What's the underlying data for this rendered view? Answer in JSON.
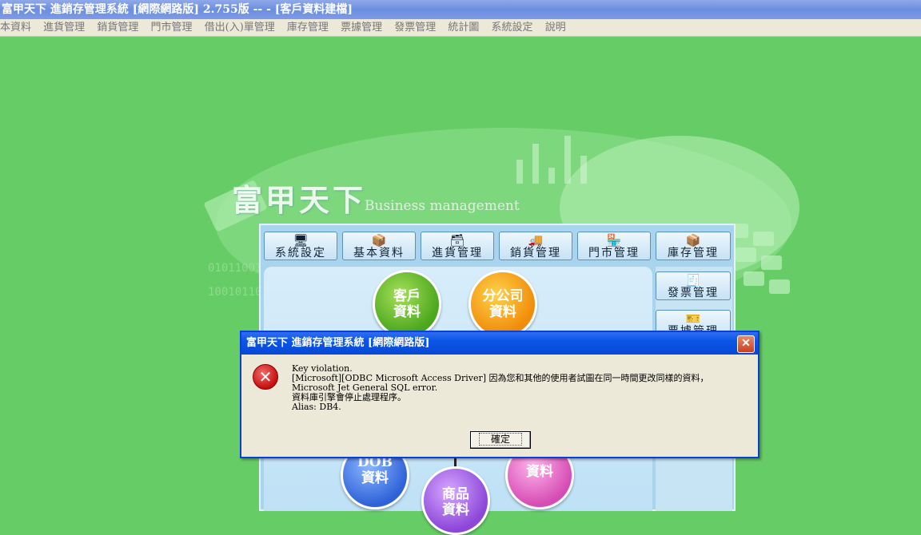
{
  "window": {
    "title": "富甲天下 進銷存管理系統 [網際網路版] 2.755版 -- - [客戶資料建檔]"
  },
  "menu": {
    "items": [
      "本資料",
      "進貨管理",
      "銷貨管理",
      "門市管理",
      "借出(入)單管理",
      "庫存管理",
      "票據管理",
      "發票管理",
      "統計圖",
      "系統設定",
      "說明"
    ]
  },
  "brand": {
    "name": "富甲天下",
    "tagline": "Business management"
  },
  "toolbar": {
    "buttons": [
      {
        "label": "系統設定",
        "icon": "computer-icon"
      },
      {
        "label": "基本資料",
        "icon": "box-icon"
      },
      {
        "label": "進貨管理",
        "icon": "boxes-icon"
      },
      {
        "label": "銷貨管理",
        "icon": "truck-icon"
      },
      {
        "label": "門市管理",
        "icon": "store-icon"
      },
      {
        "label": "庫存管理",
        "icon": "crates-icon"
      },
      {
        "label": "發票管理",
        "icon": "invoice-icon"
      },
      {
        "label": "票據管理",
        "icon": "ticket-icon"
      }
    ]
  },
  "flow": {
    "customer": "客戶\n資料",
    "branch": "分公司\n資料",
    "item3": "DOB\n資料",
    "product": "商品\n資料",
    "item5": "資料"
  },
  "dialog": {
    "title": "富甲天下 進銷存管理系統 [網際網路版]",
    "line1": "Key violation.",
    "line2": "[Microsoft][ODBC Microsoft Access Driver] 因為您和其他的使用者試圖在同一時間更改同樣的資料， Microsoft Jet General SQL error.",
    "line3": "資料庫引擎會停止處理程序。",
    "line4": "Alias: DB4.",
    "ok_label": "確定"
  }
}
